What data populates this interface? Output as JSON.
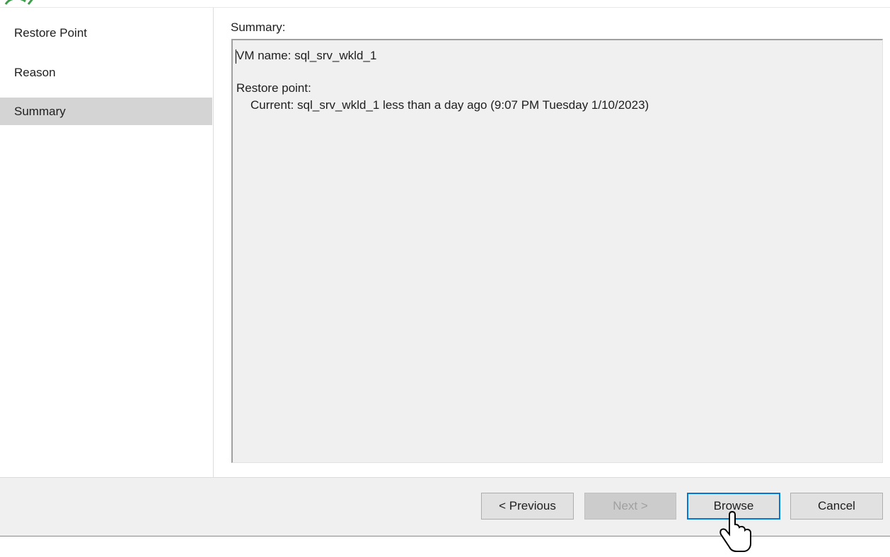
{
  "sidebar": {
    "items": [
      {
        "label": "Restore Point",
        "active": false
      },
      {
        "label": "Reason",
        "active": false
      },
      {
        "label": "Summary",
        "active": true
      }
    ]
  },
  "content": {
    "summary_label": "Summary:",
    "summary_lines": [
      "VM name: sql_srv_wkld_1",
      "Restore point:",
      "Current: sql_srv_wkld_1 less than a day ago (9:07 PM Tuesday 1/10/2023)"
    ]
  },
  "footer": {
    "previous_label": "< Previous",
    "next_label": "Next >",
    "browse_label": "Browse",
    "cancel_label": "Cancel"
  },
  "colors": {
    "active_nav": "#d4d4d4",
    "footer_bg": "#f0f0f0",
    "default_button_border": "#0078d7",
    "logo_green": "#3c9e4a"
  },
  "icons": {
    "logo": "app-logo-icon",
    "pointer": "mouse-pointer-icon"
  }
}
